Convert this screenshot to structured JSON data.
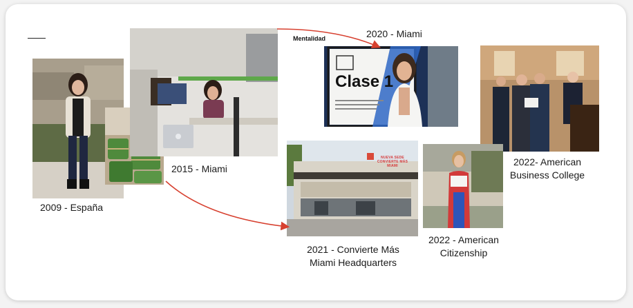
{
  "timeline": {
    "entries": [
      {
        "id": "2009",
        "caption": "2009 - España"
      },
      {
        "id": "2015",
        "caption": "2015 - Miami"
      },
      {
        "id": "2020",
        "caption": "2020 - Miami"
      },
      {
        "id": "2021",
        "caption_line1": "2021 - Convierte Más",
        "caption_line2": "Miami Headquarters"
      },
      {
        "id": "2022-citizenship",
        "caption_line1": "2022 - American",
        "caption_line2": "Citizenship"
      },
      {
        "id": "2022-college",
        "caption_line1": "2022- American",
        "caption_line2": "Business College"
      }
    ],
    "mentalidad_label": "Mentalidad",
    "clase_label": "Clase 1",
    "sede_label_line1": "NUEVA SEDE",
    "sede_label_line2": "CONVIERTE MÁS",
    "sede_label_line3": "MIAMI"
  },
  "colors": {
    "arrow": "#d7402f",
    "card": "#ffffff",
    "background": "#f3f3f3"
  }
}
